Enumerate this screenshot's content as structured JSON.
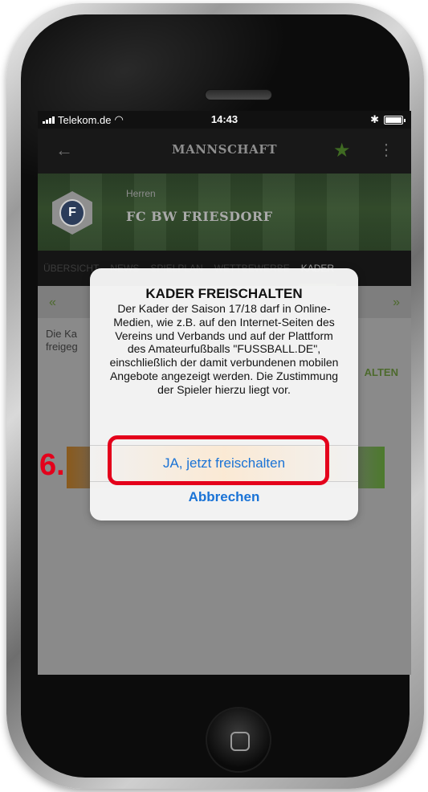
{
  "status_bar": {
    "carrier": "Telekom.de",
    "time": "14:43",
    "wifi_icon": "wifi-icon",
    "bluetooth_icon": "bluetooth-icon",
    "battery_icon": "battery-icon"
  },
  "app_bar": {
    "back_icon": "back-arrow-icon",
    "title": "MANNSCHAFT",
    "star_icon": "star-icon",
    "more_icon": "more-vertical-icon"
  },
  "team": {
    "category": "Herren",
    "name": "FC BW FRIESDORF",
    "crest_letter": "F"
  },
  "tabs": [
    {
      "label": "ÜBERSICHT",
      "active": false
    },
    {
      "label": "NEWS",
      "active": false
    },
    {
      "label": "SPIELPLAN",
      "active": false
    },
    {
      "label": "WETTBEWERBE",
      "active": false
    },
    {
      "label": "KADER",
      "active": true
    }
  ],
  "content": {
    "pager_prev": "«",
    "pager_next": "»",
    "info_text": "Die Ka freigeg",
    "side_action": "ALTEN"
  },
  "dialog": {
    "title": "KADER FREISCHALTEN",
    "message": "Der Kader der Saison 17/18 darf in Online-Medien, wie z.B. auf den Internet-Seiten des Vereins und Verbands und auf der Plattform des Amateurfußballs \"FUSSBALL.DE\", einschließlich der damit verbundenen mobilen Angebote angezeigt werden. Die Zustimmung der Spieler hierzu liegt vor.",
    "confirm_label": "JA, jetzt freischalten",
    "cancel_label": "Abbrechen"
  },
  "annotation": {
    "step": "6.",
    "color": "#e4001b"
  },
  "colors": {
    "accent_green": "#3f6a22",
    "ios_blue": "#1a73d6"
  }
}
